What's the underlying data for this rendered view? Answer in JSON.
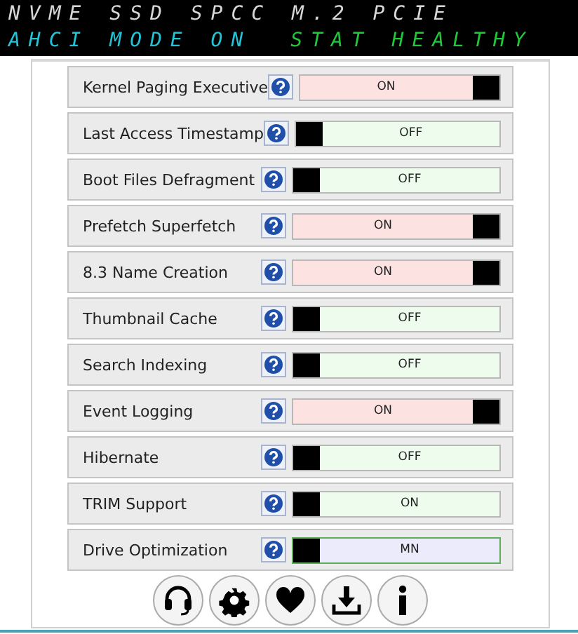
{
  "banner": {
    "line1": "NVME SSD SPCC M.2 PCIE",
    "mode": "AHCI MODE ON",
    "status": "STAT HEALTHY"
  },
  "settings": [
    {
      "label": "Kernel Paging Executive",
      "on": true,
      "value": "ON",
      "focused": false
    },
    {
      "label": "Last Access Timestamp",
      "on": false,
      "value": "OFF",
      "focused": false
    },
    {
      "label": "Boot Files Defragment",
      "on": false,
      "value": "OFF",
      "focused": false
    },
    {
      "label": "Prefetch Superfetch",
      "on": true,
      "value": "ON",
      "focused": false
    },
    {
      "label": "8.3 Name Creation",
      "on": true,
      "value": "ON",
      "focused": false
    },
    {
      "label": "Thumbnail Cache",
      "on": false,
      "value": "OFF",
      "focused": false
    },
    {
      "label": "Search Indexing",
      "on": false,
      "value": "OFF",
      "focused": false
    },
    {
      "label": "Event Logging",
      "on": true,
      "value": "ON",
      "focused": false
    },
    {
      "label": "Hibernate",
      "on": false,
      "value": "OFF",
      "focused": false
    },
    {
      "label": "TRIM Support",
      "on": false,
      "value": "ON",
      "focused": false
    },
    {
      "label": "Drive Optimization",
      "on": false,
      "value": "MN",
      "focused": true
    }
  ],
  "toolbar": [
    {
      "kind": "headset"
    },
    {
      "kind": "gear"
    },
    {
      "kind": "heart"
    },
    {
      "kind": "download"
    },
    {
      "kind": "info"
    }
  ]
}
